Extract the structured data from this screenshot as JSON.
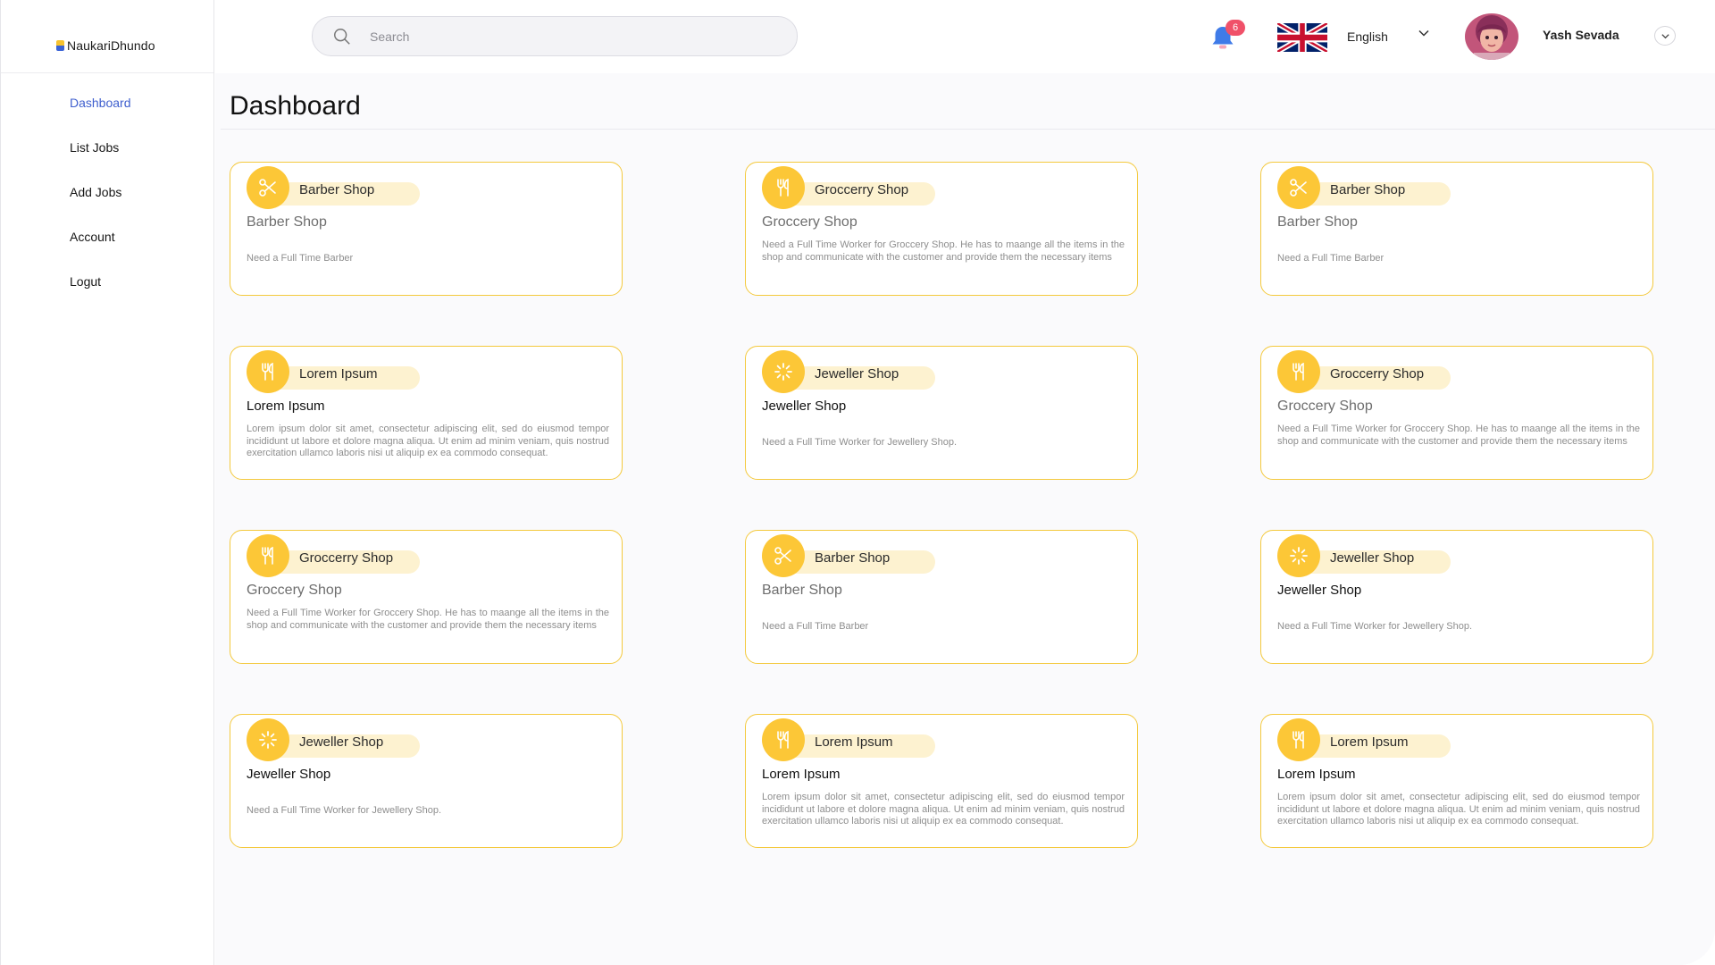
{
  "brand": {
    "name": "NaukariDhundo"
  },
  "sidebar": {
    "items": [
      {
        "label": "Dashboard",
        "active": true
      },
      {
        "label": "List Jobs"
      },
      {
        "label": "Add Jobs"
      },
      {
        "label": "Account"
      },
      {
        "label": "Logut"
      }
    ]
  },
  "topbar": {
    "search_placeholder": "Search",
    "notifications_count": "6",
    "language": "English",
    "user_name": "Yash Sevada"
  },
  "page": {
    "title": "Dashboard"
  },
  "colors": {
    "accent": "#fcc737",
    "card_border": "#f4c93d",
    "chip_bg": "#fdf2d0",
    "nav_active": "#3f5fce",
    "badge": "#f05169"
  },
  "cards": [
    {
      "icon": "scissors-icon",
      "category": "Barber Shop",
      "title": "Barber Shop",
      "title_dark": false,
      "description": "Need a Full Time Barber",
      "short": true
    },
    {
      "icon": "fork-knife-icon",
      "category": "Groccerry Shop",
      "title": "Groccery Shop",
      "title_dark": false,
      "description": "Need a Full Time Worker for Groccery Shop. He has to maange all the items in the shop and communicate with the customer and provide them the necessary  items",
      "short": false
    },
    {
      "icon": "scissors-icon",
      "category": "Barber Shop",
      "title": "Barber Shop",
      "title_dark": false,
      "description": "Need a Full Time Barber",
      "short": true
    },
    {
      "icon": "fork-knife-icon",
      "category": "Lorem Ipsum",
      "title": "Lorem Ipsum",
      "title_dark": true,
      "description": "Lorem ipsum dolor sit amet, consectetur adipiscing elit, sed do eiusmod tempor incididunt ut labore et dolore magna aliqua. Ut enim ad minim veniam, quis nostrud exercitation ullamco laboris nisi ut aliquip ex ea commodo consequat.",
      "short": false
    },
    {
      "icon": "sparkle-icon",
      "category": "Jeweller Shop",
      "title": "Jeweller Shop",
      "title_dark": true,
      "description": "Need a Full Time Worker for Jewellery Shop.",
      "short": true
    },
    {
      "icon": "fork-knife-icon",
      "category": "Groccerry Shop",
      "title": "Groccery Shop",
      "title_dark": false,
      "description": "Need a Full Time Worker for Groccery Shop. He has to maange all the items in the shop and communicate with the customer and provide them the necessary  items",
      "short": false
    },
    {
      "icon": "fork-knife-icon",
      "category": "Groccerry Shop",
      "title": "Groccery Shop",
      "title_dark": false,
      "description": "Need a Full Time Worker for Groccery Shop. He has to maange all the items in the shop and communicate with the customer and provide them the necessary  items",
      "short": false
    },
    {
      "icon": "scissors-icon",
      "category": "Barber Shop",
      "title": "Barber Shop",
      "title_dark": false,
      "description": "Need a Full Time Barber",
      "short": true
    },
    {
      "icon": "sparkle-icon",
      "category": "Jeweller Shop",
      "title": "Jeweller Shop",
      "title_dark": true,
      "description": "Need a Full Time Worker for Jewellery Shop.",
      "short": true
    },
    {
      "icon": "sparkle-icon",
      "category": "Jeweller Shop",
      "title": "Jeweller Shop",
      "title_dark": true,
      "description": "Need a Full Time Worker for Jewellery Shop.",
      "short": true
    },
    {
      "icon": "fork-knife-icon",
      "category": "Lorem Ipsum",
      "title": "Lorem Ipsum",
      "title_dark": true,
      "description": "Lorem ipsum dolor sit amet, consectetur adipiscing elit, sed do eiusmod tempor incididunt ut labore et dolore magna aliqua. Ut enim ad minim veniam, quis nostrud exercitation ullamco laboris nisi ut aliquip ex ea commodo consequat.",
      "short": false
    },
    {
      "icon": "fork-knife-icon",
      "category": "Lorem Ipsum",
      "title": "Lorem Ipsum",
      "title_dark": true,
      "description": "Lorem ipsum dolor sit amet, consectetur adipiscing elit, sed do eiusmod tempor incididunt ut labore et dolore magna aliqua. Ut enim ad minim veniam, quis nostrud exercitation ullamco laboris nisi ut aliquip ex ea commodo consequat.",
      "short": false
    }
  ]
}
